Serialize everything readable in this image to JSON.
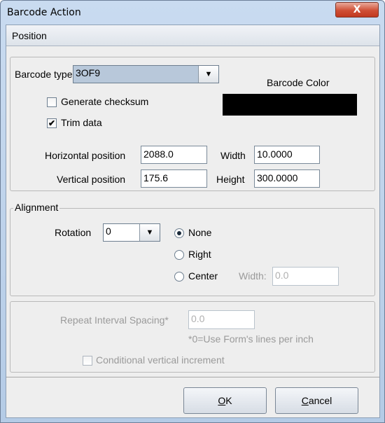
{
  "window": {
    "title": "Barcode Action",
    "close_glyph": "X"
  },
  "tab": {
    "label": "Position"
  },
  "position": {
    "barcode_type_label": "Barcode type",
    "barcode_type_value": "3OF9",
    "barcode_color_label": "Barcode Color",
    "barcode_color_hex": "#000000",
    "generate_checksum_label": "Generate checksum",
    "generate_checksum_checked": false,
    "trim_data_label": "Trim data",
    "trim_data_checked": true,
    "trim_data_mark": "✔",
    "horizontal_label": "Horizontal position",
    "horizontal_value": "2088.0",
    "width_label": "Width",
    "width_value": "10.0000",
    "vertical_label": "Vertical position",
    "vertical_value": "175.6",
    "height_label": "Height",
    "height_value": "300.0000"
  },
  "alignment": {
    "legend": "Alignment",
    "rotation_label": "Rotation",
    "rotation_value": "0",
    "options": [
      {
        "label": "None",
        "selected": true
      },
      {
        "label": "Right",
        "selected": false
      },
      {
        "label": "Center",
        "selected": false
      }
    ],
    "center_width_label": "Width:",
    "center_width_value": "0.0"
  },
  "repeat": {
    "label": "Repeat Interval Spacing*",
    "value": "0.0",
    "note": "*0=Use Form's lines per inch",
    "conditional_label": "Conditional vertical increment"
  },
  "buttons": {
    "ok_mnemonic": "O",
    "ok_rest": "K",
    "cancel_mnemonic": "C",
    "cancel_rest": "ancel"
  },
  "icons": {
    "dropdown_arrow": "▼"
  }
}
